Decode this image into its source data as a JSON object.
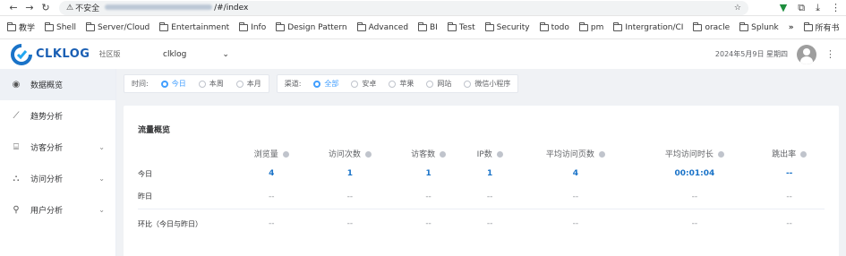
{
  "browser": {
    "insecure_label": "不安全",
    "url_path": "/#/index",
    "more_label": "»",
    "all_bookmarks_label": "所有书"
  },
  "bookmarks": [
    "教学",
    "Shell",
    "Server/Cloud",
    "Entertainment",
    "Info",
    "Design Pattern",
    "Advanced",
    "BI",
    "Test",
    "Security",
    "todo",
    "pm",
    "Intergration/CI",
    "oracle",
    "Splunk"
  ],
  "header": {
    "logo_text": "CLKLOG",
    "edition": "社区版",
    "project": "clklog",
    "date": "2024年5月9日 星期四"
  },
  "sidebar": {
    "items": [
      {
        "label": "数据概览",
        "icon": "dashboard-icon"
      },
      {
        "label": "趋势分析",
        "icon": "trend-icon"
      },
      {
        "label": "访客分析",
        "icon": "visitor-icon"
      },
      {
        "label": "访问分析",
        "icon": "access-icon"
      },
      {
        "label": "用户分析",
        "icon": "user-icon"
      }
    ]
  },
  "filters": {
    "time_label": "时间:",
    "time_options": [
      "今日",
      "本周",
      "本月"
    ],
    "channel_label": "渠道:",
    "channel_options": [
      "全部",
      "安卓",
      "苹果",
      "网站",
      "微信小程序"
    ]
  },
  "overview": {
    "title": "流量概览",
    "columns": [
      "浏览量",
      "访问次数",
      "访客数",
      "IP数",
      "平均访问页数",
      "平均访问时长",
      "跳出率"
    ],
    "rows": [
      {
        "label": "今日",
        "values": [
          "4",
          "1",
          "1",
          "1",
          "4",
          "00:01:04",
          "--"
        ]
      },
      {
        "label": "昨日",
        "values": [
          "--",
          "--",
          "--",
          "--",
          "--",
          "--",
          "--"
        ]
      },
      {
        "label": "环比（今日与昨日）",
        "values": [
          "--",
          "--",
          "--",
          "--",
          "--",
          "--",
          "--"
        ]
      }
    ]
  }
}
